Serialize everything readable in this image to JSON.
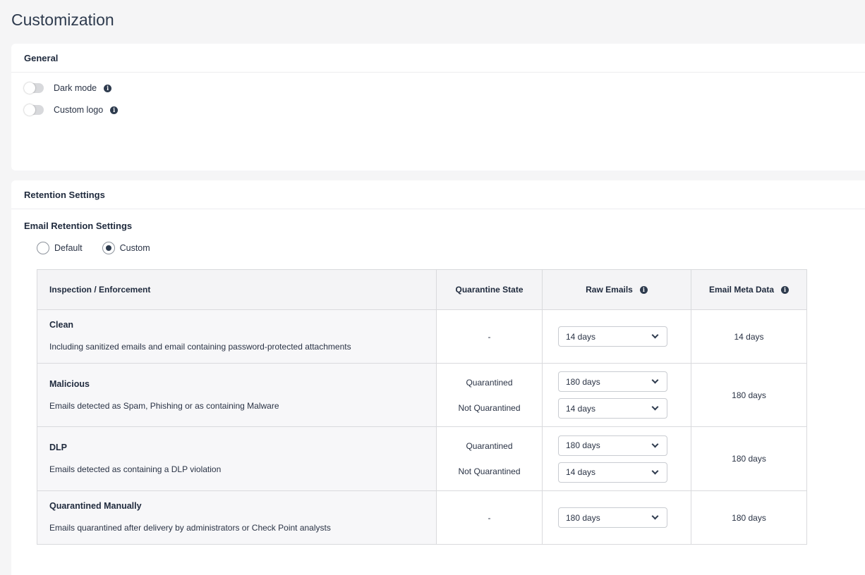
{
  "page": {
    "title": "Customization"
  },
  "general": {
    "title": "General",
    "toggles": [
      {
        "label": "Dark mode",
        "enabled": false
      },
      {
        "label": "Custom logo",
        "enabled": false
      }
    ]
  },
  "retention": {
    "title": "Retention Settings",
    "email_title": "Email Retention Settings",
    "radio_options": [
      {
        "label": "Default",
        "selected": false
      },
      {
        "label": "Custom",
        "selected": true
      }
    ],
    "table": {
      "headers": {
        "inspection": "Inspection / Enforcement",
        "quarantine": "Quarantine State",
        "raw": "Raw Emails",
        "meta": "Email Meta Data"
      },
      "rows": [
        {
          "title": "Clean",
          "desc": "Including sanitized emails and email containing password-protected attachments",
          "q1": "-",
          "raw1": "14 days",
          "meta": "14 days"
        },
        {
          "title": "Malicious",
          "desc": "Emails detected as Spam, Phishing or as containing Malware",
          "q1": "Quarantined",
          "q2": "Not Quarantined",
          "raw1": "180 days",
          "raw2": "14 days",
          "meta": "180 days"
        },
        {
          "title": "DLP",
          "desc": "Emails detected as containing a DLP violation",
          "q1": "Quarantined",
          "q2": "Not Quarantined",
          "raw1": "180 days",
          "raw2": "14 days",
          "meta": "180 days"
        },
        {
          "title": "Quarantined Manually",
          "desc": "Emails quarantined after delivery by administrators or Check Point analysts",
          "q1": "-",
          "raw1": "180 days",
          "meta": "180 days"
        }
      ]
    }
  },
  "icons": {
    "info": "info-icon",
    "dropdown": "chevron-down-icon"
  },
  "colors": {
    "text": "#1f2a3d",
    "background": "#f5f5f6",
    "card": "#ffffff",
    "accent": "#2e3b4e"
  }
}
